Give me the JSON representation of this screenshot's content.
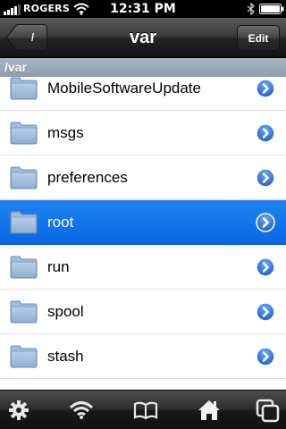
{
  "status_bar": {
    "carrier": "ROGERS",
    "time": "12:31 PM",
    "icons": [
      "signal-icon",
      "wifi-icon",
      "bluetooth-icon",
      "battery-icon"
    ]
  },
  "nav": {
    "back_label": "/",
    "title": "var",
    "edit_label": "Edit"
  },
  "path_header": "/var",
  "list": {
    "items": [
      {
        "label": "MobileSoftwareUpdate",
        "selected": false
      },
      {
        "label": "msgs",
        "selected": false
      },
      {
        "label": "preferences",
        "selected": false
      },
      {
        "label": "root",
        "selected": true
      },
      {
        "label": "run",
        "selected": false
      },
      {
        "label": "spool",
        "selected": false
      },
      {
        "label": "stash",
        "selected": false
      }
    ]
  },
  "toolbar": {
    "icons": [
      "gear-icon",
      "wifi-icon",
      "book-icon",
      "home-icon",
      "windows-icon"
    ]
  },
  "colors": {
    "selection": "#0a66e4",
    "disclosure": "#2b6fd8",
    "header": "#9aa8b7"
  }
}
